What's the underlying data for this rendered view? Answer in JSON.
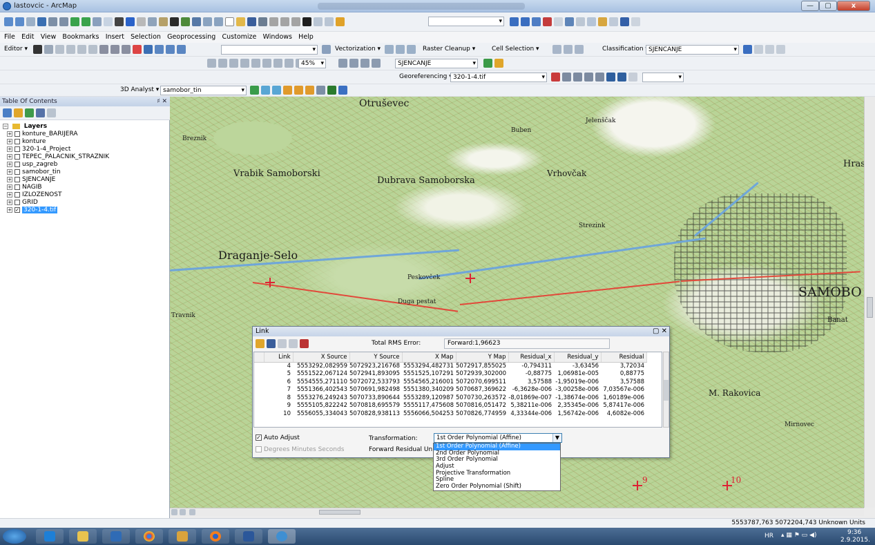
{
  "window": {
    "title": "lastovcic - ArcMap",
    "min": "—",
    "max": "▢",
    "close": "x"
  },
  "menu": [
    "File",
    "Edit",
    "View",
    "Bookmarks",
    "Insert",
    "Selection",
    "Geoprocessing",
    "Customize",
    "Windows",
    "Help"
  ],
  "toolbars": {
    "editor": "Editor ▾",
    "vectorization": "Vectorization ▾",
    "raster_cleanup": "Raster Cleanup ▾",
    "cell_selection": "Cell Selection ▾",
    "classification": "Classification ▾",
    "classification_layer": "SJENCANJE",
    "zoom_pct": "45%",
    "layer_select": "SJENCANJE",
    "georeferencing": "Georeferencing ▾",
    "georef_layer": "320-1-4.tif",
    "analyst_3d": "3D Analyst ▾",
    "analyst_layer": "samobor_tin"
  },
  "toc": {
    "title": "Table Of Contents",
    "pin": "♯ ✕",
    "root": "Layers",
    "layers": [
      {
        "name": "konture_BARIJERA",
        "checked": false
      },
      {
        "name": "konture",
        "checked": false
      },
      {
        "name": "320-1-4_Project",
        "checked": false
      },
      {
        "name": "TEPEC_PALACNIK_STRAZNIK",
        "checked": false
      },
      {
        "name": "usp_zagreb",
        "checked": false
      },
      {
        "name": "samobor_tin",
        "checked": false
      },
      {
        "name": "SJENCANJE",
        "checked": false
      },
      {
        "name": "NAGIB",
        "checked": false
      },
      {
        "name": "IZLOZENOST",
        "checked": false
      },
      {
        "name": "GRID",
        "checked": false
      },
      {
        "name": "320-1-4.tif",
        "checked": true,
        "selected": true
      }
    ]
  },
  "map_labels": {
    "otrusevec": "Otruševec",
    "vrabik": "Vrabik Samoborski",
    "dubrava": "Dubrava Samoborska",
    "vrhovcak": "Vrhovčak",
    "draganje": "Draganje-Selo",
    "samobo": "SAMOBO",
    "rakovica": "M. Rakovica",
    "hrast": "Hrast",
    "breznik": "Breznik",
    "buben": "Buben",
    "jelenscak": "Jelenščak",
    "strezink": "Strezink",
    "pescara": "Peskovček",
    "dugapestat": "Duga pestat",
    "travnik": "Travnik",
    "banat": "Banat",
    "mirnovec": "Mirnovec",
    "gcp9": "9",
    "gcp10": "10"
  },
  "link": {
    "title": "Link",
    "total_rms_label": "Total RMS Error:",
    "forward_rms": "Forward:1,96623",
    "columns": [
      "Link",
      "X Source",
      "Y Source",
      "X Map",
      "Y Map",
      "Residual_x",
      "Residual_y",
      "Residual"
    ],
    "rows": [
      [
        "4",
        "5553292,082959",
        "5072923,216768",
        "5553294,482731",
        "5072917,855025",
        "-0,794311",
        "-3,63456",
        "3,72034"
      ],
      [
        "5",
        "5551522,067124",
        "5072941,893095",
        "5551525,107291",
        "5072939,302000",
        "-0,88775",
        "1,06981e-005",
        "0,88775"
      ],
      [
        "6",
        "5554555,271110",
        "5072072,533793",
        "5554565,216001",
        "5072070,699511",
        "3,57588",
        "-1,95019e-006",
        "3,57588"
      ],
      [
        "7",
        "5551366,402543",
        "5070691,982498",
        "5551380,340209",
        "5070687,369622",
        "-6,3628e-006",
        "-3,00258e-006",
        "7,03567e-006"
      ],
      [
        "8",
        "5553276,249243",
        "5070733,890644",
        "5553289,120987",
        "5070730,263572",
        "-8,01869e-007",
        "-1,38674e-006",
        "1,60189e-006"
      ],
      [
        "9",
        "5555105,822242",
        "5070818,695579",
        "5555117,475608",
        "5070816,051472",
        "5,38211e-006",
        "2,35345e-006",
        "5,87417e-006"
      ],
      [
        "10",
        "5556055,334043",
        "5070828,938113",
        "5556066,504253",
        "5070826,774959",
        "4,33344e-006",
        "1,56742e-006",
        "4,6082e-006"
      ]
    ],
    "auto_adjust": "Auto Adjust",
    "dms": "Degrees Minutes Seconds",
    "transformation_label": "Transformation:",
    "transformation_value": "1st Order Polynomial (Affine)",
    "forward_unit": "Forward Residual Unit : Un"
  },
  "transform_options": [
    "1st Order Polynomial (Affine)",
    "2nd Order Polynomial",
    "3rd Order Polynomial",
    "Adjust",
    "Projective Transformation",
    "Spline",
    "Zero Order Polynomial (Shift)"
  ],
  "status": {
    "coords": "5553787,763  5072204,743 Unknown Units"
  },
  "tray": {
    "lang": "HR",
    "time": "9:36",
    "date": "2.9.2015."
  }
}
